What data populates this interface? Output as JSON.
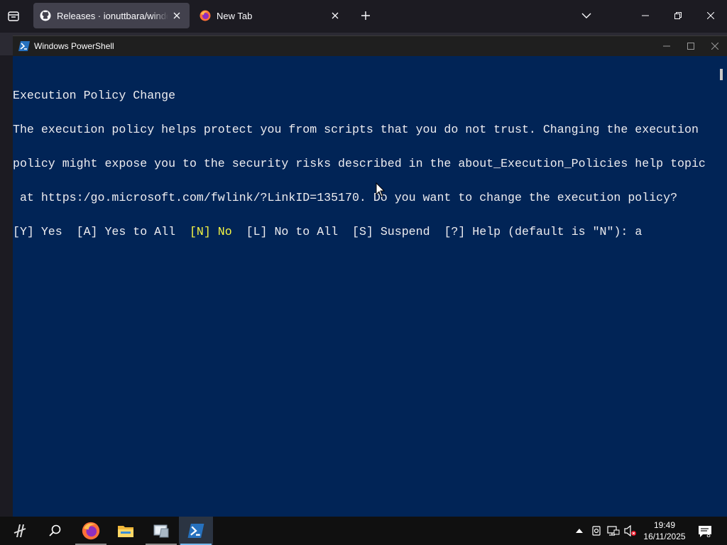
{
  "browser": {
    "tabs": [
      {
        "title": "Releases · ionuttbara/windows-defender-remover",
        "icon": "github-icon",
        "active": true
      },
      {
        "title": "New Tab",
        "icon": "firefox-icon",
        "active": false
      }
    ]
  },
  "powershell": {
    "title": "Windows PowerShell",
    "console_lines": [
      "Execution Policy Change",
      "The execution policy helps protect you from scripts that you do not trust. Changing the execution",
      "policy might expose you to the security risks described in the about_Execution_Policies help topic",
      " at https:/go.microsoft.com/fwlink/?LinkID=135170. Do you want to change the execution policy?"
    ],
    "prompt": {
      "yes": "[Y] Yes  ",
      "yes_all": "[A] Yes to All  ",
      "no": "[N] No  ",
      "no_all": "[L] No to All  ",
      "suspend": "[S] Suspend  ",
      "help": "[?] Help (default is \"N\"): ",
      "input": "a"
    }
  },
  "taskbar": {
    "apps": [
      "start-icon",
      "search-icon",
      "firefox-icon",
      "file-explorer-icon",
      "app-icon",
      "powershell-icon"
    ],
    "time": "19:49",
    "date": "16/11/2025",
    "notification_count": "8"
  },
  "colors": {
    "console_bg": "#012456",
    "console_text": "#eeedf0",
    "highlight": "#f5f543",
    "taskbar_bg": "#101010"
  }
}
